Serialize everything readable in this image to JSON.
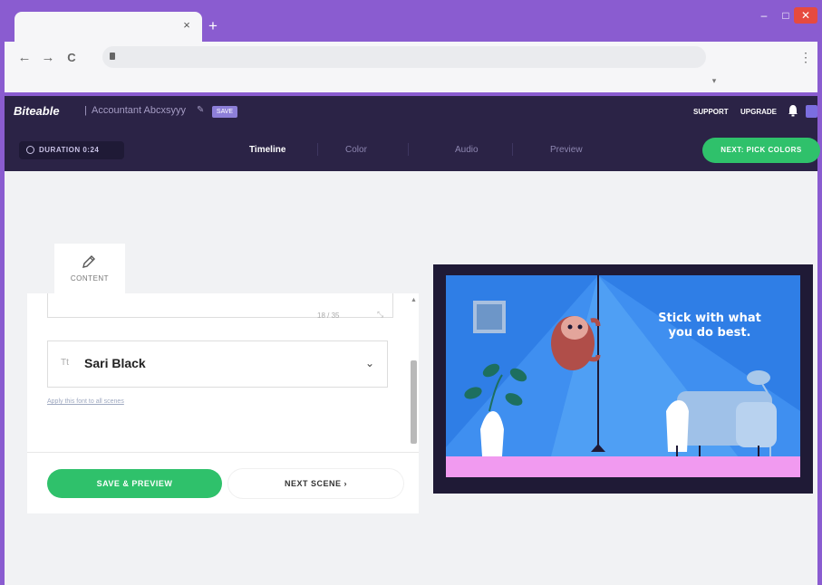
{
  "browser": {
    "tab_title": "",
    "tab_close": "×",
    "new_tab": "+",
    "back": "←",
    "forward": "→",
    "reload": "C",
    "menu": "⋮",
    "extension": "▾",
    "window_min": "–",
    "window_max": "□",
    "window_close": "✕"
  },
  "app": {
    "logo": "Biteable",
    "separator": "|",
    "project_name": "Accountant Abcxsyyy",
    "edit_icon": "✎",
    "save_pill": "SAVE",
    "support": "SUPPORT",
    "upgrade": "UPGRADE"
  },
  "steps": {
    "duration": "DURATION 0:24",
    "items": [
      "Timeline",
      "Color",
      "Audio",
      "Preview"
    ],
    "active": "Timeline",
    "next_button": "NEXT: PICK COLORS"
  },
  "editor": {
    "edit_tab_label": "CONTENT",
    "char_count": "18 / 35",
    "font_prefix": "Tt",
    "font_name": "Sari Black",
    "apply_link": "Apply this font to all scenes",
    "save_preview": "SAVE & PREVIEW",
    "next_scene": "NEXT SCENE ›"
  },
  "preview": {
    "headline": "Stick with what you do best."
  },
  "colors": {
    "chrome_purple": "#8a5cd0",
    "app_dark": "#2b2346",
    "green_accent": "#2fc16b",
    "scene_blue": "#2f7ee6",
    "scene_pink": "#f19af0"
  }
}
